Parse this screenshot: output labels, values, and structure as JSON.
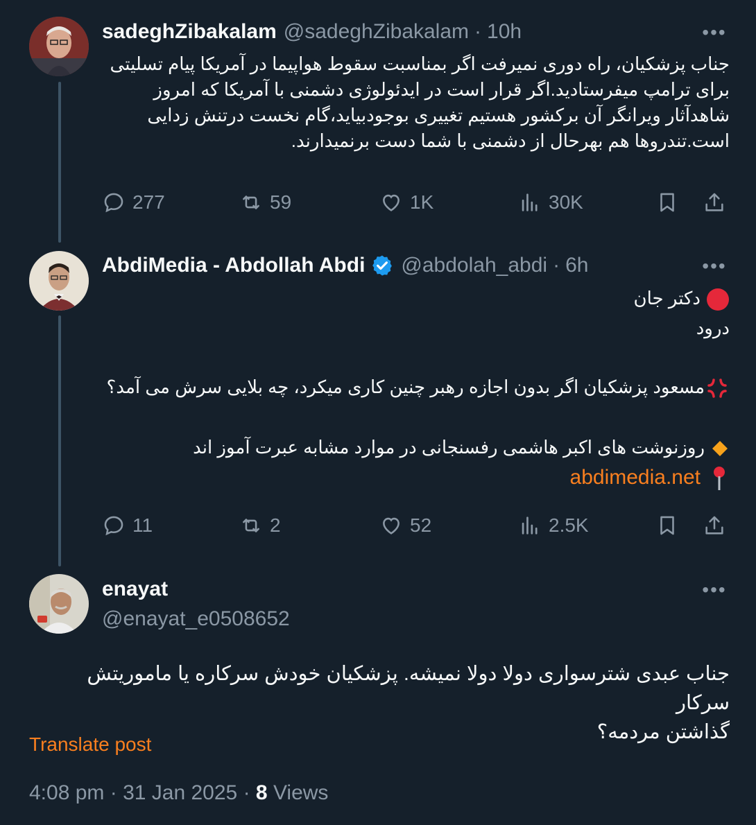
{
  "tweets": [
    {
      "name": "sadeghZibakalam",
      "handle": "@sadeghZibakalam",
      "time": "10h",
      "text_lines": [
        "جناب پزشکیان، راه دوری نمیرفت اگر بمناسبت سقوط هواپیما در آمریکا پیام تسلیتی",
        "برای ترامپ میفرستادید.اگر قرار است در ایدئولوژی دشمنی با آمریکا که امروز",
        "شاهدآثار ویرانگر آن برکشور هستیم تغییری بوجودبیاید،گام نخست درتنش زدایی",
        "است.تندروها هم بهرحال از دشمنی با شما دست برنمیدارند."
      ],
      "replies": "277",
      "reposts": "59",
      "likes": "1K",
      "views": "30K"
    },
    {
      "name": "AbdiMedia - Abdollah Abdi",
      "handle": "@abdolah_abdi",
      "time": "6h",
      "line1": "دکتر جان",
      "line2": "درود",
      "line3": "مسعود پزشکیان اگر بدون اجازه رهبر چنین کاری میکرد، چه بلایی سرش می آمد؟",
      "line4": "روزنوشت های اکبر هاشمی رفسنجانی در موارد مشابه عبرت آموز اند",
      "link": "abdimedia.net",
      "replies": "11",
      "reposts": "2",
      "likes": "52",
      "views": "2.5K"
    },
    {
      "name": "enayat",
      "handle": "@enayat_e0508652",
      "text_lines": [
        "جناب عبدی شترسواری دولا دولا نمیشه. پزشکیان خودش سرکاره یا ماموریتش سرکار",
        "گذاشتن مردمه؟"
      ]
    }
  ],
  "translate_label": "Translate post",
  "footer": {
    "time": "4:08 pm",
    "date": "31 Jan 2025",
    "views_count": "8",
    "views_label": "Views"
  },
  "colors": {
    "background": "#15202b",
    "accent": "#f97f1f",
    "muted": "#8b98a5",
    "verified": "#1d9bf0"
  }
}
